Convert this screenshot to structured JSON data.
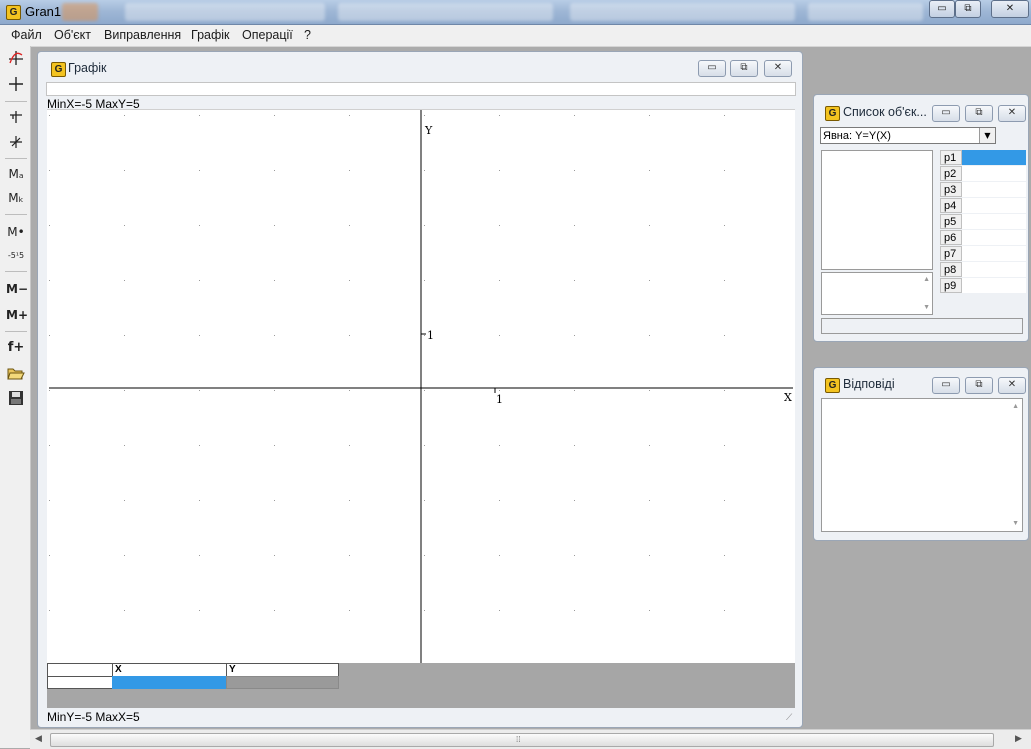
{
  "app": {
    "title": "Gran1",
    "icon_letter": "G"
  },
  "window_controls": {
    "minimize": "▭",
    "restore": "⧉",
    "close": "✕"
  },
  "menu": [
    "Файл",
    "Об'єкт",
    "Виправлення",
    "Графік",
    "Операції",
    "?"
  ],
  "toolbar": [
    "Mₐ",
    "Mₖ",
    "M•",
    "-5¹5",
    "M−",
    "M+",
    "f+"
  ],
  "graph_window": {
    "title": "Графік",
    "top_info": "MinX=-5  MaxY=5",
    "bottom_info": "MinY=-5  MaxX=5",
    "axis_x_label": "X",
    "axis_y_label": "Y",
    "tick_x": "1",
    "tick_y": "1",
    "table_headers": [
      "X",
      "Y"
    ]
  },
  "object_list_window": {
    "title": "Список об'єк...",
    "type_selected": "Явна: Y=Y(X)",
    "params": [
      "p1",
      "p2",
      "p3",
      "p4",
      "p5",
      "p6",
      "p7",
      "p8",
      "p9"
    ]
  },
  "answers_window": {
    "title": "Відповіді"
  },
  "colors": {
    "selection": "#3399e6",
    "titlebar": "#a9bfdc",
    "workspace": "#ababab"
  }
}
